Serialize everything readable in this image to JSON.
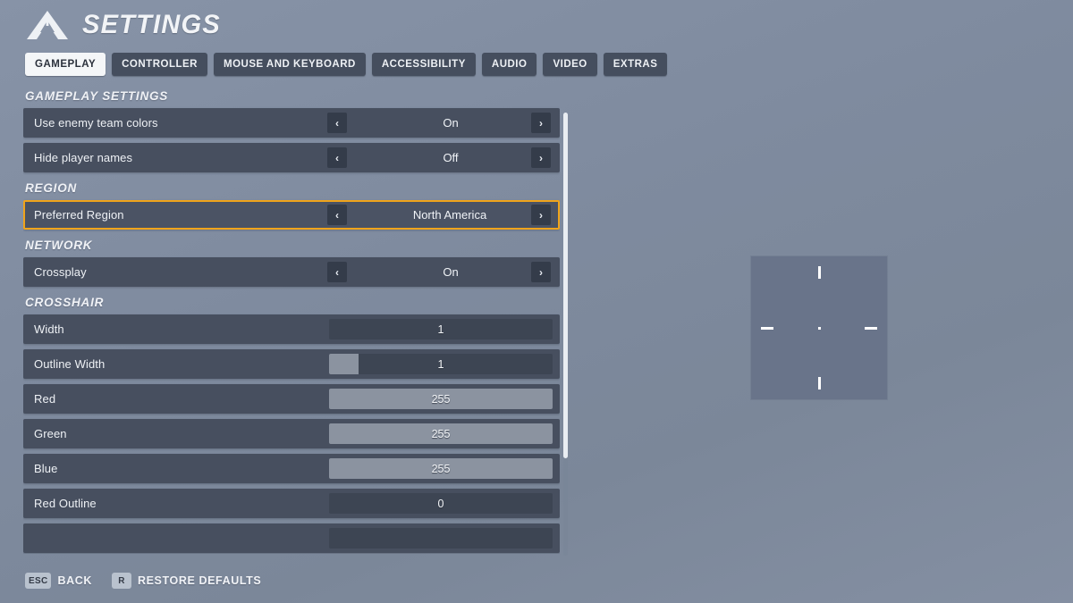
{
  "header": {
    "title": "SETTINGS",
    "logo_icon": "overwatch-triangle-logo-icon"
  },
  "tabs": [
    {
      "label": "GAMEPLAY",
      "active": true
    },
    {
      "label": "CONTROLLER",
      "active": false
    },
    {
      "label": "MOUSE AND KEYBOARD",
      "active": false
    },
    {
      "label": "ACCESSIBILITY",
      "active": false
    },
    {
      "label": "AUDIO",
      "active": false
    },
    {
      "label": "VIDEO",
      "active": false
    },
    {
      "label": "EXTRAS",
      "active": false
    }
  ],
  "arrows": {
    "left_glyph": "‹",
    "right_glyph": "›"
  },
  "sections": [
    {
      "heading": "GAMEPLAY SETTINGS",
      "rows": [
        {
          "label": "Use enemy team colors",
          "type": "option",
          "value": "On",
          "selected": false
        },
        {
          "label": "Hide player names",
          "type": "option",
          "value": "Off",
          "selected": false
        }
      ]
    },
    {
      "heading": "REGION",
      "rows": [
        {
          "label": "Preferred Region",
          "type": "option",
          "value": "North America",
          "selected": true
        }
      ]
    },
    {
      "heading": "NETWORK",
      "rows": [
        {
          "label": "Crossplay",
          "type": "option",
          "value": "On",
          "selected": false
        }
      ]
    },
    {
      "heading": "CROSSHAIR",
      "rows": [
        {
          "label": "Width",
          "type": "slider",
          "value": "1",
          "fill_percent": 0,
          "selected": false
        },
        {
          "label": "Outline Width",
          "type": "slider",
          "value": "1",
          "fill_percent": 13,
          "selected": false
        },
        {
          "label": "Red",
          "type": "slider",
          "value": "255",
          "fill_percent": 100,
          "selected": false
        },
        {
          "label": "Green",
          "type": "slider",
          "value": "255",
          "fill_percent": 100,
          "selected": false
        },
        {
          "label": "Blue",
          "type": "slider",
          "value": "255",
          "fill_percent": 100,
          "selected": false
        },
        {
          "label": "Red Outline",
          "type": "slider",
          "value": "0",
          "fill_percent": 0,
          "selected": false
        },
        {
          "label": "",
          "type": "slider",
          "value": "",
          "fill_percent": 0,
          "selected": false,
          "clipped": true
        }
      ]
    }
  ],
  "scrollbar": {
    "thumb_percent": 78
  },
  "crosshair_preview": {
    "name": "crosshair-preview",
    "ticks": [
      "top",
      "bottom",
      "left",
      "right",
      "center-dot"
    ]
  },
  "footer": {
    "hints": [
      {
        "key": "ESC",
        "label": "BACK"
      },
      {
        "key": "R",
        "label": "RESTORE DEFAULTS"
      }
    ]
  },
  "colors": {
    "accent_selected": "#f0a41b",
    "row_bg": "#474f5f",
    "slider_track": "#3d4553",
    "slider_fill": "#8b93a0",
    "background": "#808da3",
    "tab_active_bg": "#f4f6f8"
  }
}
